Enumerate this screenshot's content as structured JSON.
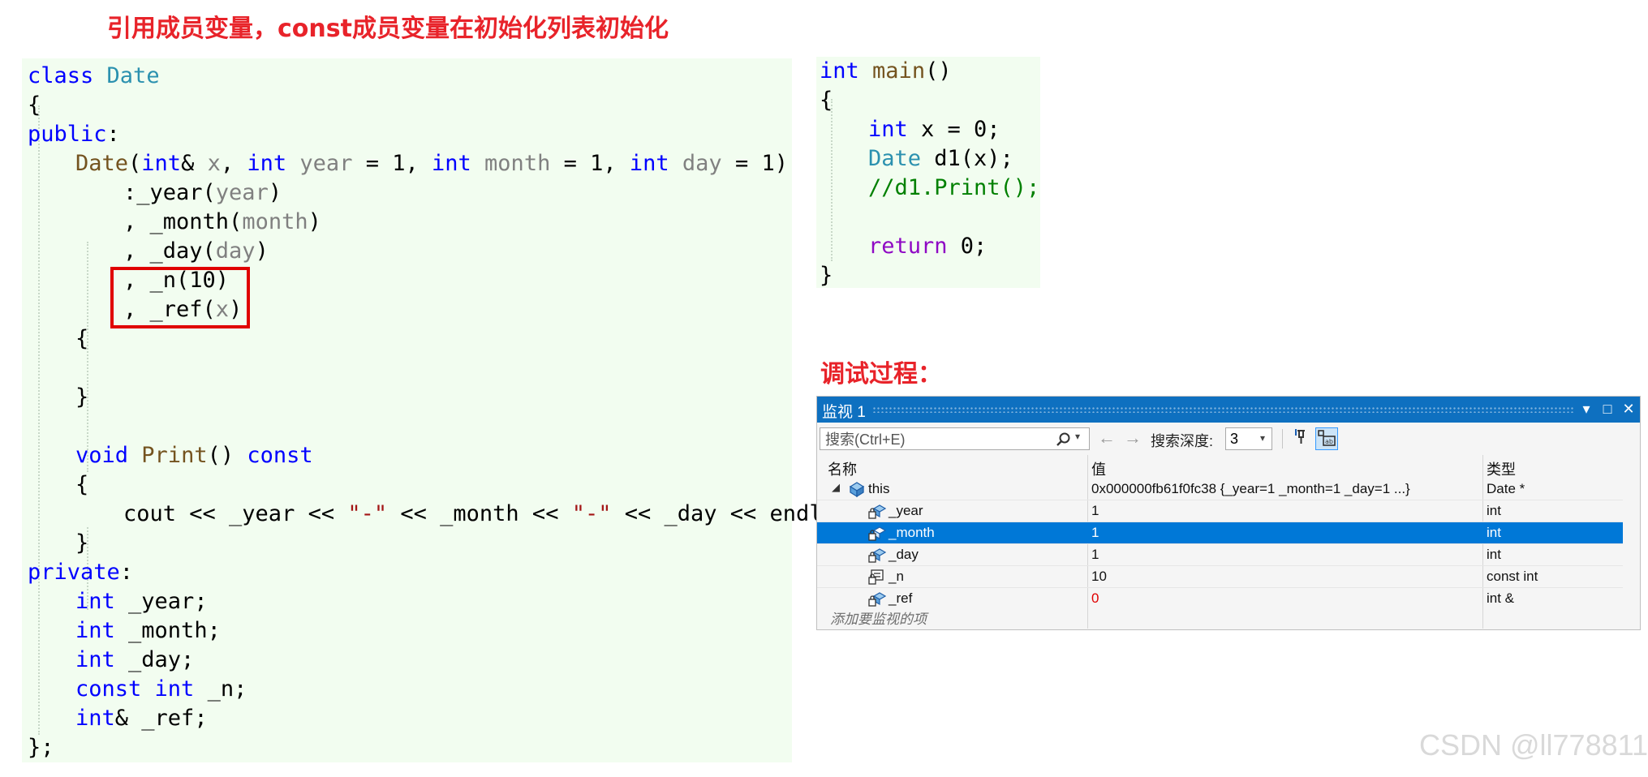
{
  "headings": {
    "top": "引用成员变量，const成员变量在初始化列表初始化",
    "debug": "调试过程："
  },
  "class_code": {
    "l01_kw": "class",
    "l01_ty": "Date",
    "l02": "{",
    "l03_kw": "public",
    "l03_p": ":",
    "l04_fn": "Date",
    "l04_a": "(",
    "l04_int1": "int",
    "l04_b": "& ",
    "l04_x": "x",
    "l04_c": ", ",
    "l04_int2": "int",
    "l04_year": "year",
    "l04_d": " = 1, ",
    "l04_int3": "int",
    "l04_month": "month",
    "l04_e": " = 1, ",
    "l04_int4": "int",
    "l04_day": "day",
    "l04_f": " = 1)",
    "l05_a": ":_year(",
    "l05_p": "year",
    "l05_b": ")",
    "l06_a": ", _month(",
    "l06_p": "month",
    "l06_b": ")",
    "l07_a": ", _day(",
    "l07_p": "day",
    "l07_b": ")",
    "l08": ", _n(10)",
    "l09_a": ", _ref(",
    "l09_p": "x",
    "l09_b": ")",
    "l10": "{",
    "l11": "}",
    "l12_kw": "void",
    "l12_fn": "Print",
    "l12_a": "() ",
    "l12_const": "const",
    "l13": "{",
    "l14_a": "cout << _year << ",
    "l14_s1": "\"-\"",
    "l14_b": " << _month << ",
    "l14_s2": "\"-\"",
    "l14_c": " << _day << endl;",
    "l15": "}",
    "l16_kw": "private",
    "l16_p": ":",
    "l17_kw": "int",
    "l17_v": " _year;",
    "l18_kw": "int",
    "l18_v": " _month;",
    "l19_kw": "int",
    "l19_v": " _day;",
    "l20_kw1": "const",
    "l20_kw2": "int",
    "l20_v": " _n;",
    "l21_kw": "int",
    "l21_v": "& _ref;",
    "l22": "};"
  },
  "main_code": {
    "m1_kw": "int",
    "m1_fn": "main",
    "m1_p": "()",
    "m2": "{",
    "m3_kw": "int",
    "m3_v": " x = 0;",
    "m4_ty": "Date",
    "m4_v": " d1(x);",
    "m5_cm": "//d1.Print();",
    "m6_kw": "return",
    "m6_v": " 0;",
    "m7": "}"
  },
  "watch": {
    "title": "监视 1",
    "search_placeholder": "搜索(Ctrl+E)",
    "back_arrow": "←",
    "forward_arrow": "→",
    "depth_label": "搜索深度:",
    "depth_value": "3",
    "columns": {
      "name": "名称",
      "value": "值",
      "type": "类型"
    },
    "rows": [
      {
        "name": "this",
        "value": "0x000000fb61f0fc38 {_year=1 _month=1 _day=1 ...}",
        "type": "Date *"
      },
      {
        "name": "_year",
        "value": "1",
        "type": "int"
      },
      {
        "name": "_month",
        "value": "1",
        "type": "int"
      },
      {
        "name": "_day",
        "value": "1",
        "type": "int"
      },
      {
        "name": "_n",
        "value": "10",
        "type": "const int"
      },
      {
        "name": "_ref",
        "value": "0",
        "type": "int &"
      }
    ],
    "add_item": "添加要监视的项",
    "colors": {
      "title_bar": "#0e70c0",
      "selected_row": "#0078d7",
      "changed_value": "#e00000"
    }
  },
  "watermark": "CSDN @ll778811"
}
